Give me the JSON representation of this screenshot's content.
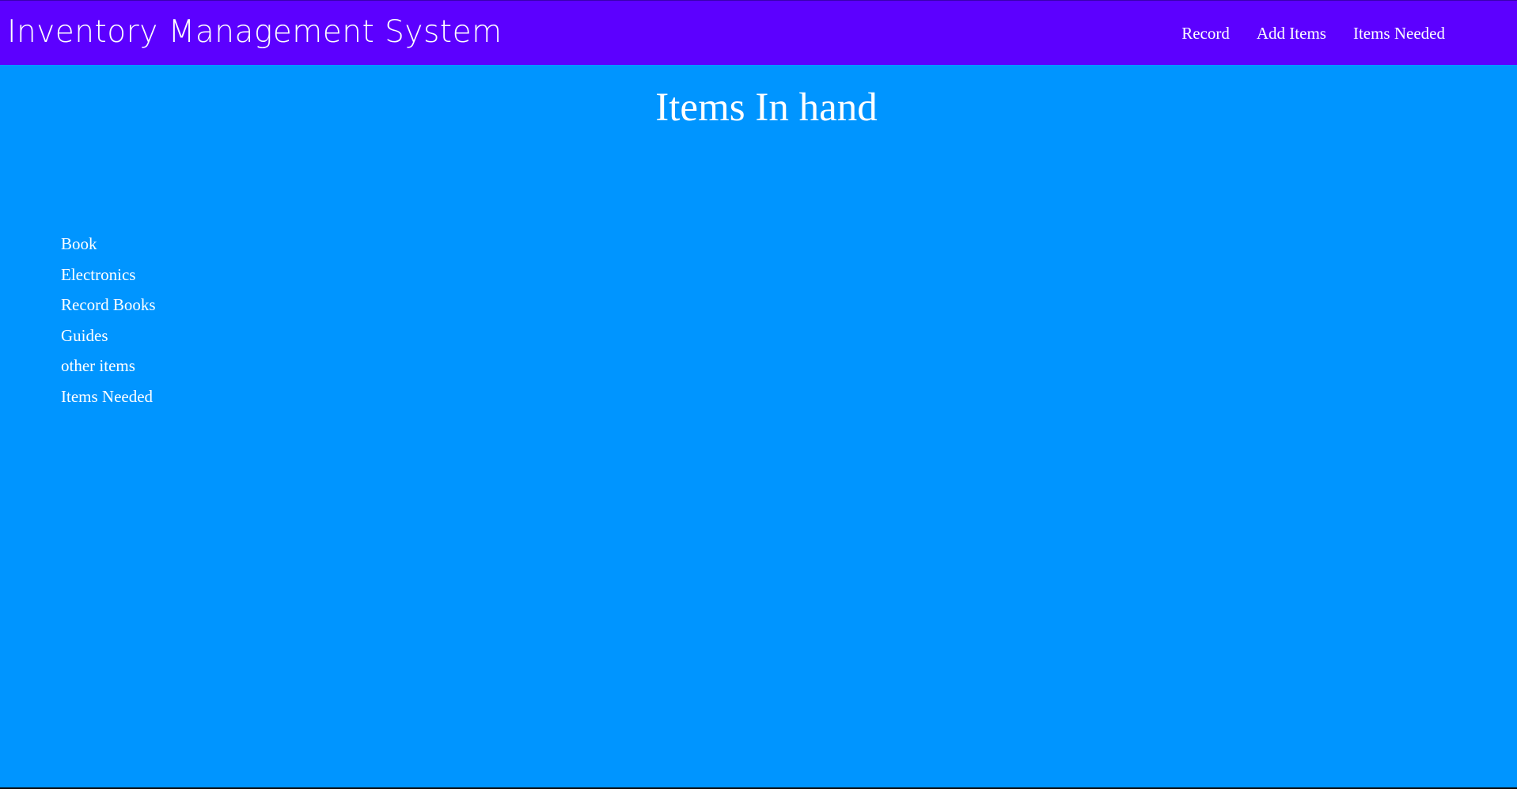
{
  "header": {
    "brand": "Inventory Management System",
    "nav": [
      "Record",
      "Add Items",
      "Items Needed"
    ]
  },
  "main": {
    "heading": "Items In hand",
    "categories": [
      "Book",
      "Electronics",
      "Record Books",
      "Guides",
      "other items",
      "Items Needed"
    ]
  },
  "colors": {
    "header_background": "#5c00ff",
    "page_background": "#0095ff",
    "text": "#ffffff"
  }
}
